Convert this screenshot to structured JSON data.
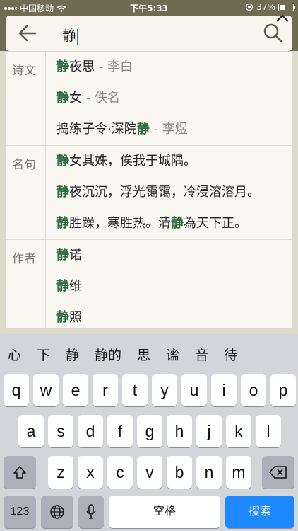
{
  "status": {
    "carrier": "中国移动",
    "time": "下午5:33",
    "battery_text": "37%",
    "battery_level": 0.37
  },
  "search": {
    "query": "静"
  },
  "results": [
    {
      "label": "诗文",
      "items": [
        {
          "parts": [
            [
              "静",
              true
            ],
            [
              "夜思",
              false
            ]
          ],
          "author": " - 李白"
        },
        {
          "parts": [
            [
              "静",
              true
            ],
            [
              "女",
              false
            ]
          ],
          "author": " - 佚名"
        },
        {
          "parts": [
            [
              "捣练子令·深院",
              false
            ],
            [
              "静",
              true
            ]
          ],
          "author": " - 李煜"
        }
      ]
    },
    {
      "label": "名句",
      "items": [
        {
          "parts": [
            [
              "静",
              true
            ],
            [
              "女其姝，俟我于城隅。",
              false
            ]
          ],
          "author": ""
        },
        {
          "parts": [
            [
              "静",
              true
            ],
            [
              "夜沉沉，浮光霭霭，冷浸溶溶月。",
              false
            ]
          ],
          "author": ""
        },
        {
          "parts": [
            [
              "静",
              true
            ],
            [
              "胜躁，寒胜热。清",
              false
            ],
            [
              "静",
              true
            ],
            [
              "為天下正。",
              false
            ]
          ],
          "author": ""
        }
      ]
    },
    {
      "label": "作者",
      "items": [
        {
          "parts": [
            [
              "静",
              true
            ],
            [
              "诺",
              false
            ]
          ],
          "author": ""
        },
        {
          "parts": [
            [
              "静",
              true
            ],
            [
              "维",
              false
            ]
          ],
          "author": ""
        },
        {
          "parts": [
            [
              "静",
              true
            ],
            [
              "照",
              false
            ]
          ],
          "author": ""
        }
      ]
    }
  ],
  "candidates": [
    "心",
    "下",
    "静",
    "静的",
    "思",
    "谧",
    "音",
    "待"
  ],
  "keyboard": {
    "row1": [
      "q",
      "w",
      "e",
      "r",
      "t",
      "y",
      "u",
      "i",
      "o",
      "p"
    ],
    "row2": [
      "a",
      "s",
      "d",
      "f",
      "g",
      "h",
      "j",
      "k",
      "l"
    ],
    "row3": [
      "z",
      "x",
      "c",
      "v",
      "b",
      "n",
      "m"
    ],
    "numbers_label": "123",
    "space_label": "空格",
    "search_label": "搜索"
  },
  "colors": {
    "header": "#6f6c53",
    "highlight": "#2d6a3f",
    "search_key": "#1e88ff"
  }
}
